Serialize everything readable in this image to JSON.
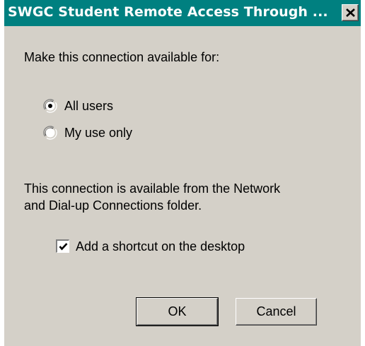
{
  "window": {
    "title": "SWGC Student Remote Access Through ..."
  },
  "availability": {
    "prompt": "Make this connection available for:",
    "options": [
      {
        "label": "All users",
        "selected": true
      },
      {
        "label": "My use only",
        "selected": false
      }
    ]
  },
  "info": {
    "line1": "This connection is available from the Network",
    "line2": "and Dial-up Connections folder."
  },
  "shortcut": {
    "label": "Add a shortcut on the desktop",
    "checked": true
  },
  "buttons": {
    "ok": "OK",
    "cancel": "Cancel"
  },
  "colors": {
    "titlebar": "#008080",
    "face": "#d4d0c8"
  }
}
